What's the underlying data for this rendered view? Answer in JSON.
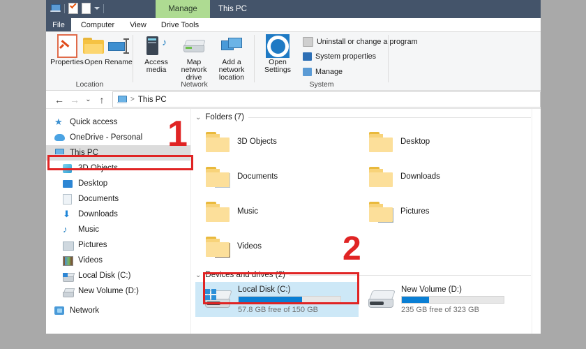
{
  "titlebar": {
    "quick_access": [
      "this-pc-icon",
      "properties-check-icon",
      "paste-icon",
      "customize-caret-icon"
    ],
    "contextual_tab": "Manage",
    "window_title": "This PC"
  },
  "ribbon_tabs": [
    {
      "label": "File",
      "active": false
    },
    {
      "label": "Computer",
      "active": true
    },
    {
      "label": "View",
      "active": false
    },
    {
      "label": "Drive Tools",
      "active": false
    }
  ],
  "ribbon": {
    "groups": [
      {
        "label": "Location",
        "buttons": [
          {
            "label": "Properties",
            "icon": "properties-icon"
          },
          {
            "label": "Open",
            "icon": "open-folder-icon"
          },
          {
            "label": "Rename",
            "icon": "rename-icon"
          }
        ]
      },
      {
        "label": "Network",
        "buttons": [
          {
            "label": "Access media",
            "icon": "access-media-icon",
            "dropdown": true
          },
          {
            "label": "Map network drive",
            "icon": "map-network-drive-icon",
            "dropdown": true
          },
          {
            "label": "Add a network location",
            "icon": "add-network-location-icon",
            "dropdown": false
          }
        ]
      },
      {
        "label": "System",
        "open_settings": "Open Settings",
        "items": [
          {
            "label": "Uninstall or change a program",
            "color": "#b9b9b9"
          },
          {
            "label": "System properties",
            "color": "#2d6fb5"
          },
          {
            "label": "Manage",
            "color": "#5b9bd5"
          }
        ]
      }
    ]
  },
  "addressbar": {
    "back": "←",
    "forward": "→",
    "recent": "⌄",
    "up": "↑",
    "breadcrumb_root": "This PC",
    "separator": ">"
  },
  "navpane": {
    "items": [
      {
        "label": "Quick access",
        "icon": "star-icon",
        "indent": false,
        "selected": false
      },
      {
        "label": "OneDrive - Personal",
        "icon": "cloud-icon",
        "indent": false,
        "selected": false
      },
      {
        "label": "This PC",
        "icon": "this-pc-icon",
        "indent": false,
        "selected": true
      },
      {
        "label": "3D Objects",
        "icon": "3d-objects-icon",
        "indent": true,
        "selected": false
      },
      {
        "label": "Desktop",
        "icon": "desktop-icon",
        "indent": true,
        "selected": false
      },
      {
        "label": "Documents",
        "icon": "documents-icon",
        "indent": true,
        "selected": false
      },
      {
        "label": "Downloads",
        "icon": "downloads-icon",
        "indent": true,
        "selected": false
      },
      {
        "label": "Music",
        "icon": "music-icon",
        "indent": true,
        "selected": false
      },
      {
        "label": "Pictures",
        "icon": "pictures-icon",
        "indent": true,
        "selected": false
      },
      {
        "label": "Videos",
        "icon": "videos-icon",
        "indent": true,
        "selected": false
      },
      {
        "label": "Local Disk (C:)",
        "icon": "local-disk-icon",
        "indent": true,
        "selected": false
      },
      {
        "label": "New Volume (D:)",
        "icon": "drive-icon",
        "indent": true,
        "selected": false
      },
      {
        "label": "Network",
        "icon": "network-icon",
        "indent": false,
        "selected": false
      }
    ]
  },
  "content": {
    "folders_section": {
      "header": "Folders (7)",
      "chevron": "⌄",
      "items": [
        {
          "name": "3D Objects",
          "emblem": "3d-objects-emblem"
        },
        {
          "name": "Desktop",
          "emblem": "desktop-emblem"
        },
        {
          "name": "Documents",
          "emblem": "documents-emblem"
        },
        {
          "name": "Downloads",
          "emblem": "downloads-emblem"
        },
        {
          "name": "Music",
          "emblem": "music-emblem"
        },
        {
          "name": "Pictures",
          "emblem": "pictures-emblem"
        },
        {
          "name": "Videos",
          "emblem": "videos-emblem"
        }
      ]
    },
    "drives_section": {
      "header": "Devices and drives (2)",
      "chevron": "⌄",
      "items": [
        {
          "name": "Local Disk (C:)",
          "free_text": "57.8 GB free of 150 GB",
          "used_percent": 62,
          "selected": true,
          "has_windows_logo": true
        },
        {
          "name": "New Volume (D:)",
          "free_text": "235 GB free of 323 GB",
          "used_percent": 27,
          "selected": false,
          "has_windows_logo": false
        }
      ]
    }
  },
  "annotations": [
    {
      "number": "1",
      "target": "this-pc-nav-item"
    },
    {
      "number": "2",
      "target": "local-disk-c-tile"
    }
  ],
  "colors": {
    "titlebar": "#44546a",
    "contextual_tab": "#aedb92",
    "annotation_red": "#e02424",
    "selection_blue": "#cde8f7",
    "progress_blue": "#0a7fd4",
    "page_background": "#a9a9a9"
  }
}
